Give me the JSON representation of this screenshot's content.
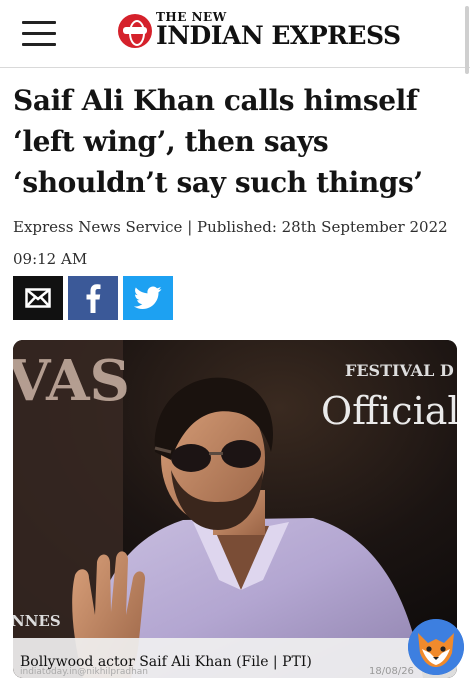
{
  "header": {
    "logo_top": "THE NEW",
    "logo_name": "INDIAN EXPRESS"
  },
  "article": {
    "headline": "Saif Ali Khan calls himself ‘left wing’, then says ‘shouldn’t say such things’",
    "byline": "Express News Service",
    "separator": "|",
    "published": "Published: 28th September 2022 09:12 AM"
  },
  "share": {
    "email_icon": "envelope-icon",
    "facebook_icon": "facebook-icon",
    "twitter_icon": "twitter-icon"
  },
  "photo": {
    "backdrop_text_left": "VAS",
    "backdrop_text_right_top": "FESTIVAL D",
    "backdrop_text_right": "Official",
    "backdrop_text_bottom_left": "NNES",
    "caption": "Bollywood actor Saif Ali Khan (File | PTI)",
    "watermark": "indiatoday.in@nikhilpradhan",
    "datestamp": "18/08/26"
  },
  "colors": {
    "brand_red": "#d5212b",
    "facebook": "#3b5998",
    "twitter": "#1da1f2",
    "email": "#111111"
  }
}
